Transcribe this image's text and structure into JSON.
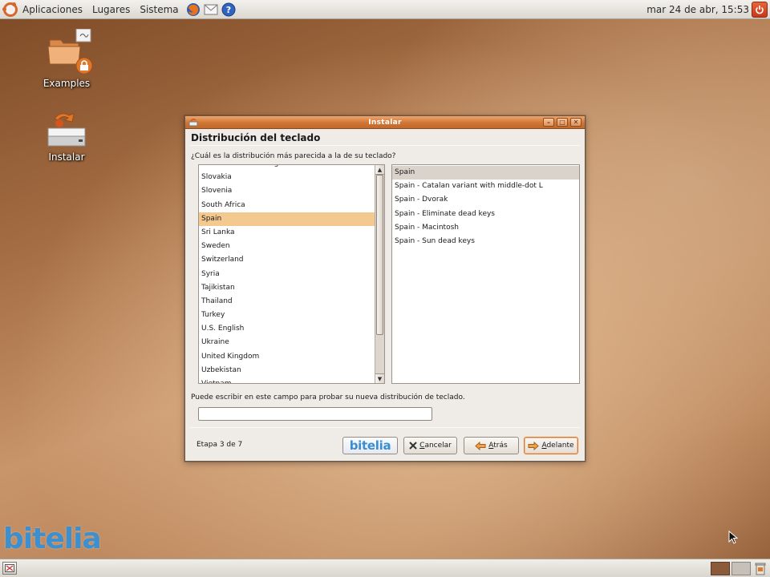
{
  "top_panel": {
    "menus": [
      "Aplicaciones",
      "Lugares",
      "Sistema"
    ],
    "clock": "mar 24 de abr, 15:53"
  },
  "desktop": {
    "icons": [
      {
        "label": "Examples"
      },
      {
        "label": "Instalar"
      }
    ],
    "corner_logo": "bitelia"
  },
  "window": {
    "title": "Instalar",
    "heading": "Distribución del teclado",
    "question": "¿Cuál es la distribución más parecida a la de su teclado?",
    "countries": [
      "Serbia and Montenegro",
      "Slovakia",
      "Slovenia",
      "South Africa",
      "Spain",
      "Sri Lanka",
      "Sweden",
      "Switzerland",
      "Syria",
      "Tajikistan",
      "Thailand",
      "Turkey",
      "U.S. English",
      "Ukraine",
      "United Kingdom",
      "Uzbekistan",
      "Vietnam"
    ],
    "selected_country": "Spain",
    "variants": [
      "Spain",
      "Spain - Catalan variant with middle-dot L",
      "Spain - Dvorak",
      "Spain - Eliminate dead keys",
      "Spain - Macintosh",
      "Spain - Sun dead keys"
    ],
    "selected_variant": "Spain",
    "test_hint": "Puede escribir en este campo para probar su nueva distribución de teclado.",
    "test_value": "",
    "step": "Etapa 3 de 7",
    "brand_button": "bitelia",
    "buttons": {
      "cancel_u": "C",
      "cancel_rest": "ancelar",
      "back_u": "A",
      "back_rest": "trás",
      "forward_u": "A",
      "forward_rest": "delante"
    }
  },
  "colors": {
    "accent": "#d8772e",
    "selection": "#f4c98f",
    "brand_blue": "#3a8fd0"
  }
}
